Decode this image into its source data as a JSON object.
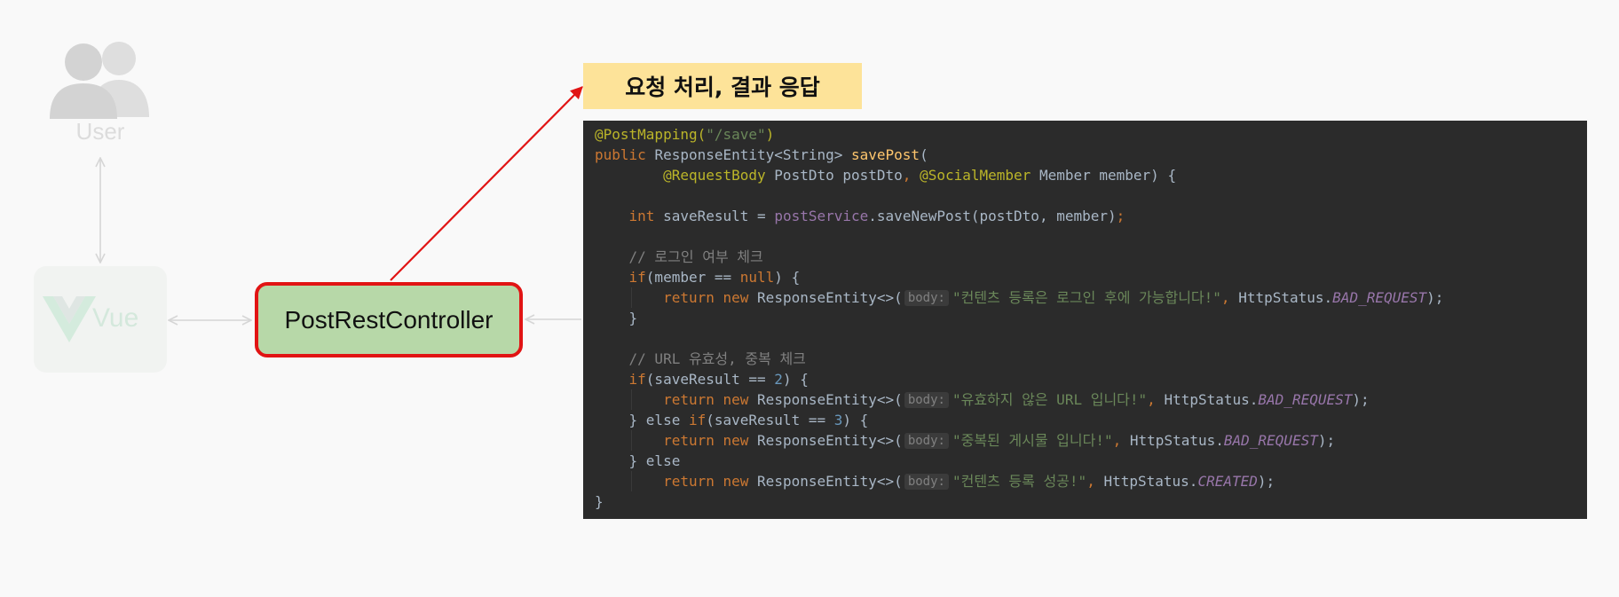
{
  "user_node": {
    "label": "User",
    "icon": "users-icon"
  },
  "vue_node": {
    "label": "Vue",
    "icon": "vue-logo-icon"
  },
  "controller_node": {
    "label": "PostRestController"
  },
  "callout": {
    "text": "요청 처리, 결과 응답"
  },
  "code": {
    "annotation_mapping": "@PostMapping(",
    "mapping_path": "\"/save\"",
    "mapping_close": ")",
    "kw_public": "public",
    "return_type": "ResponseEntity<String>",
    "method_name": "savePost",
    "paren_open": "(",
    "ann_request_body": "@RequestBody",
    "param1": "PostDto postDto",
    "comma": ",",
    "ann_social_member": "@SocialMember",
    "param2": "Member member) {",
    "kw_int": "int",
    "var_save_result": "saveResult =",
    "field_post_service": "postService",
    "save_call": ".saveNewPost(postDto, member)",
    "semicolon": ";",
    "comment_login": "// 로그인 여부 체크",
    "kw_if": "if",
    "cond_member_open": "(member ==",
    "kw_null": "null",
    "cond_close_brace": ") {",
    "kw_return": "return",
    "kw_new": "new",
    "ctor": "ResponseEntity<>(",
    "hint_body": "body:",
    "msg_login_required": "\"컨텐츠 등록은 로그인 후에 가능합니다!\"",
    "http_status": "HttpStatus.",
    "const_bad_request": "BAD_REQUEST",
    "const_created": "CREATED",
    "stmt_end": ");",
    "brace_close": "}",
    "comment_url": "// URL 유효성, 중복 체크",
    "cond_save_result": "(saveResult ==",
    "num_2": "2",
    "num_3": "3",
    "msg_invalid_url": "\"유효하지 않은 URL 입니다!\"",
    "brace_else": "} else",
    "msg_duplicate": "\"중복된 게시물 입니다!\"",
    "msg_success": "\"컨텐츠 등록 성공!\""
  },
  "colors": {
    "controller_fill": "#b7d8a8",
    "controller_border": "#e11414",
    "callout_fill": "#fde399",
    "code_background": "#2b2b2b",
    "arrow_red": "#e11414"
  }
}
